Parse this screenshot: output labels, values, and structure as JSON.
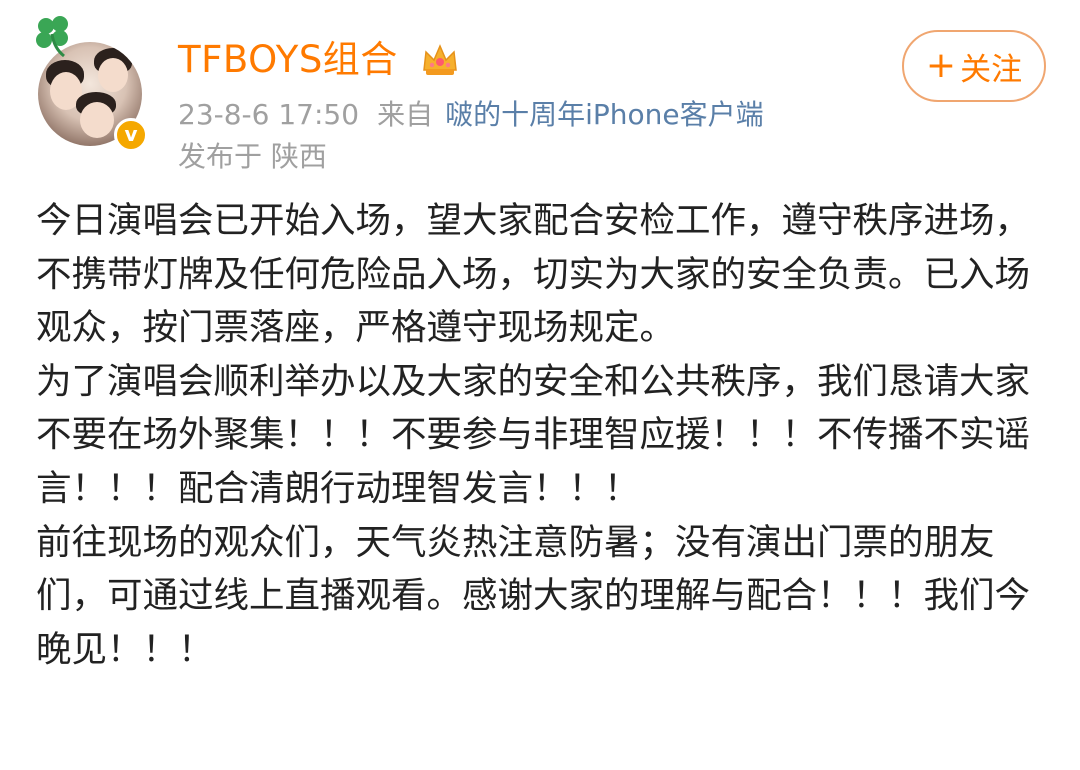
{
  "header": {
    "username": "TFBOYS组合",
    "time": "23-8-6 17:50",
    "from_label": "来自",
    "client": "啵的十周年iPhone客户端",
    "location": "发布于 陕西",
    "follow_label": "关注",
    "follow_plus": "+"
  },
  "post": {
    "paragraphs": [
      "今日演唱会已开始入场，望大家配合安检工作，遵守秩序进场，不携带灯牌及任何危险品入场，切实为大家的安全负责。已入场观众，按门票落座，严格遵守现场规定。",
      "为了演唱会顺利举办以及大家的安全和公共秩序，我们恳请大家不要在场外聚集！！！不要参与非理智应援！！！不传播不实谣言！！！配合清朗行动理智发言！！！",
      "前往现场的观众们，天气炎热注意防暑；没有演出门票的朋友们，可通过线上直播观看。感谢大家的理解与配合！！！我们今晚见！！！"
    ]
  },
  "colors": {
    "username": "#ff7a00",
    "client_link": "#5a7fa8",
    "meta": "#a0a0a0",
    "badge": "#f5a800",
    "follow_border": "#f0a670",
    "text": "#222222"
  },
  "icons": {
    "clover": "clover-icon",
    "crown": "crown-icon",
    "verified": "verified-badge-icon"
  }
}
